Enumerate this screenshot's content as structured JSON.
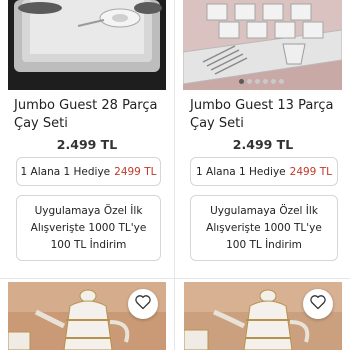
{
  "products": [
    {
      "title": "Jumbo Guest 28 Parça Çay Seti",
      "price": "2.499 TL",
      "gift_label": "1 Alana 1 Hediye",
      "gift_price": "2499 TL",
      "promo_text": "Uygulamaya Özel İlk Alışverişte 1000 TL'ye 100 TL İndirim"
    },
    {
      "title": "Jumbo Guest 13 Parça Çay Seti",
      "price": "2.499 TL",
      "gift_label": "1 Alana 1 Hediye",
      "gift_price": "2499 TL",
      "promo_text": "Uygulamaya Özel İlk Alışverişte 1000 TL'ye 100 TL İndirim",
      "carousel_dots": 6,
      "carousel_active": 1
    }
  ],
  "icons": {
    "favorite": "heart-outline-icon"
  },
  "colors": {
    "gift_price": "#c0392b",
    "border": "#d6d6d6"
  }
}
